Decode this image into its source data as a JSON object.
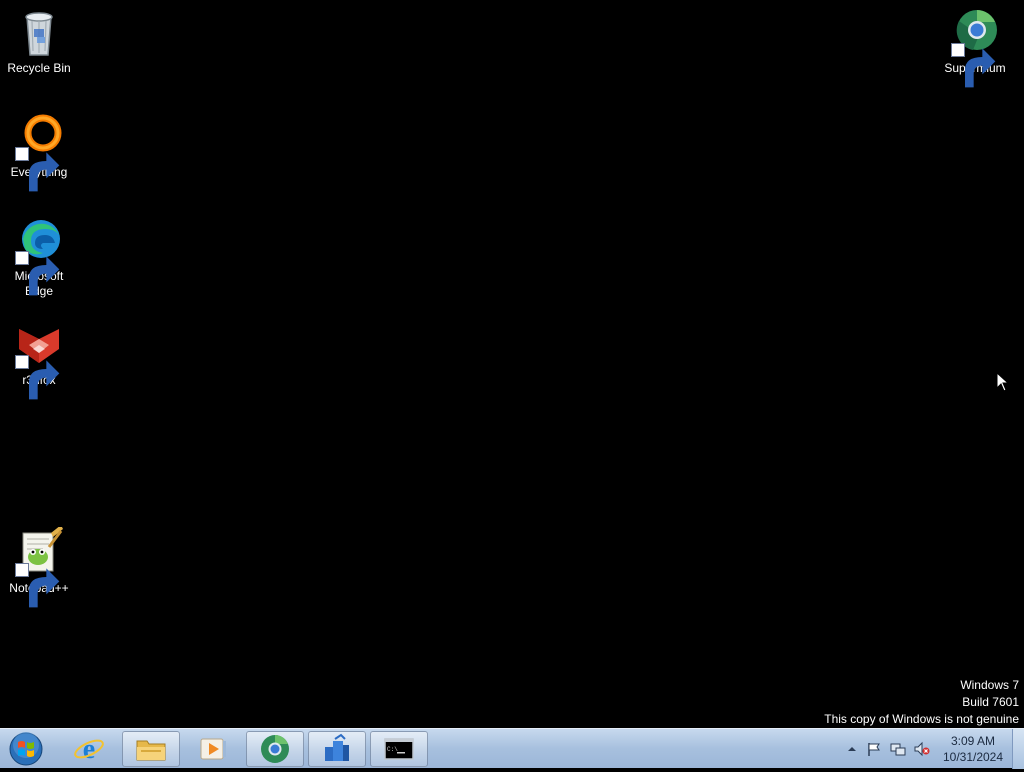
{
  "desktop": {
    "icons": [
      {
        "label": "Recycle Bin",
        "icon": "recycle-bin-icon",
        "shortcut": false
      },
      {
        "label": "Everything",
        "icon": "everything-icon",
        "shortcut": true
      },
      {
        "label": "Microsoft Edge",
        "icon": "edge-icon",
        "shortcut": true
      },
      {
        "label": "r3dfox",
        "icon": "r3dfox-icon",
        "shortcut": true
      },
      {
        "label": "Notepad++",
        "icon": "notepad-plus-plus-icon",
        "shortcut": true
      },
      {
        "label": "Supermium",
        "icon": "supermium-icon",
        "shortcut": true
      }
    ],
    "watermark": {
      "line1": "Windows 7",
      "line2": "Build 7601",
      "line3": "This copy of Windows is not genuine"
    }
  },
  "taskbar": {
    "start_icon": "windows-start-orb-icon",
    "buttons": [
      {
        "icon": "internet-explorer-icon",
        "open": false
      },
      {
        "icon": "file-explorer-icon",
        "open": true
      },
      {
        "icon": "media-player-icon",
        "open": false
      },
      {
        "icon": "supermium-icon",
        "open": true
      },
      {
        "icon": "network-app-icon",
        "open": true
      },
      {
        "icon": "command-prompt-icon",
        "open": true
      }
    ],
    "tray": {
      "icons": [
        "show-hidden-icons-arrow-icon",
        "action-center-flag-icon",
        "network-icon",
        "volume-muted-icon"
      ]
    },
    "clock": {
      "time": "3:09 AM",
      "date": "10/31/2024"
    }
  },
  "colors": {
    "desktop_background": "#000000",
    "taskbar": "#a7c0de"
  }
}
